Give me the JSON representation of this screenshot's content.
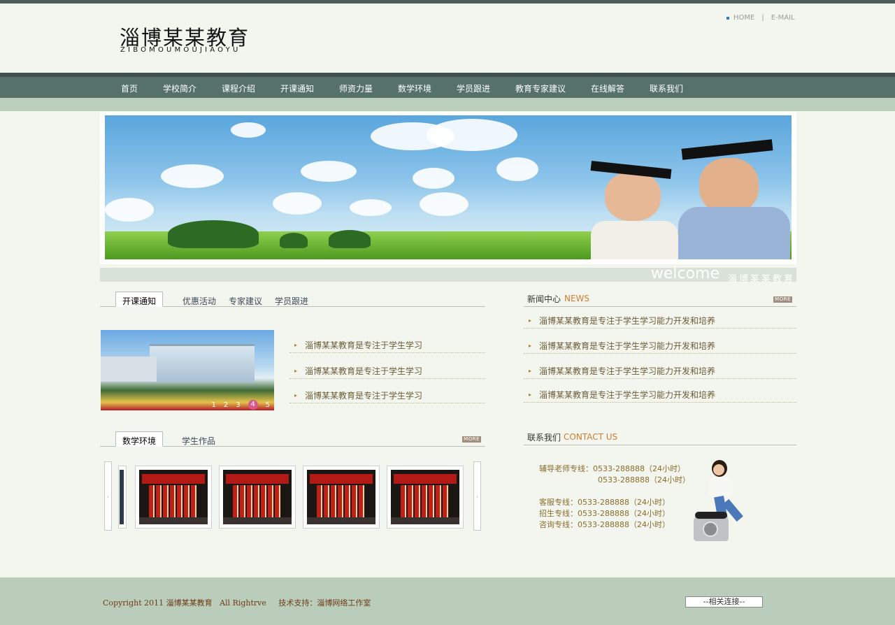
{
  "header": {
    "logo_cn": "淄博某某教育",
    "logo_en": "ZIBOMOUMOUJIAOYU",
    "home_link": "HOME",
    "separator": "|",
    "email_link": "E-MAIL"
  },
  "nav": {
    "items": [
      "首页",
      "学校简介",
      "课程介绍",
      "开课通知",
      "师资力量",
      "数学环境",
      "学员跟进",
      "教育专家建议",
      "在线解答",
      "联系我们"
    ]
  },
  "welcome": {
    "en": "welcome",
    "cn": "淄博某某教育"
  },
  "notice": {
    "tabs": [
      "开课通知",
      "优惠活动",
      "专家建议",
      "学员跟进"
    ],
    "active_tab": "开课通知",
    "pager": [
      "1",
      "2",
      "3",
      "4",
      "5"
    ],
    "active_page": "4",
    "items": [
      "淄博某某教育是专注于学生学习",
      "淄博某某教育是专注于学生学习",
      "淄博某某教育是专注于学生学习"
    ]
  },
  "news": {
    "title_cn": "新闻中心",
    "title_en": "NEWS",
    "more": "MORE",
    "items": [
      "淄博某某教育是专注于学生学习能力开发和培养",
      "淄博某某教育是专注于学生学习能力开发和培养",
      "淄博某某教育是专注于学生学习能力开发和培养",
      "淄博某某教育是专注于学生学习能力开发和培养"
    ]
  },
  "gallery": {
    "tabs": [
      "数学环境",
      "学生作品"
    ],
    "active_tab": "数学环境",
    "more": "MORE",
    "prev": "‹",
    "next": "›"
  },
  "contact": {
    "title_cn": "联系我们",
    "title_en": "CONTACT US",
    "lines": [
      "辅导老师专线：0533-288888（24小时）",
      "0533-288888（24小时）",
      "客服专线：0533-288888（24小时）",
      "招生专线：0533-288888（24小时）",
      "咨询专线：0533-288888（24小时）"
    ]
  },
  "footer": {
    "copyright": "Copyright 2011 淄博某某教育   All Rightrve     技术支持：淄博网络工作室",
    "related_links": "--相关连接--"
  },
  "colors": {
    "nav_bg": "#55716a",
    "accent_orange": "#d47c2d",
    "footer_bg": "#bacdba"
  }
}
